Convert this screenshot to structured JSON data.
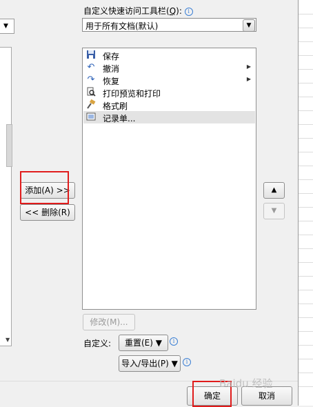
{
  "qat_label": "自定义快速访问工具栏(",
  "qat_label_key": "Q",
  "qat_label_end": "):",
  "docs_combo_value": "用于所有文档(默认)",
  "commands": [
    {
      "label": "保存",
      "icon": "save-icon"
    },
    {
      "label": "撤消",
      "icon": "undo-icon",
      "has_submenu": true
    },
    {
      "label": "恢复",
      "icon": "redo-icon",
      "has_submenu": true
    },
    {
      "label": "打印预览和打印",
      "icon": "print-preview-icon"
    },
    {
      "label": "格式刷",
      "icon": "format-painter-icon"
    },
    {
      "label": "记录单...",
      "icon": "form-icon",
      "selected": true
    }
  ],
  "add_button": "添加(A) >>",
  "remove_button": "<< 删除(R)",
  "modify_button": "修改(M)...",
  "custom_label": "自定义:",
  "reset_button": "重置(E) ▼",
  "import_export_button": "导入/导出(P) ▼",
  "ok_button": "确定",
  "cancel_button": "取消",
  "watermark": "Baidu 经验"
}
